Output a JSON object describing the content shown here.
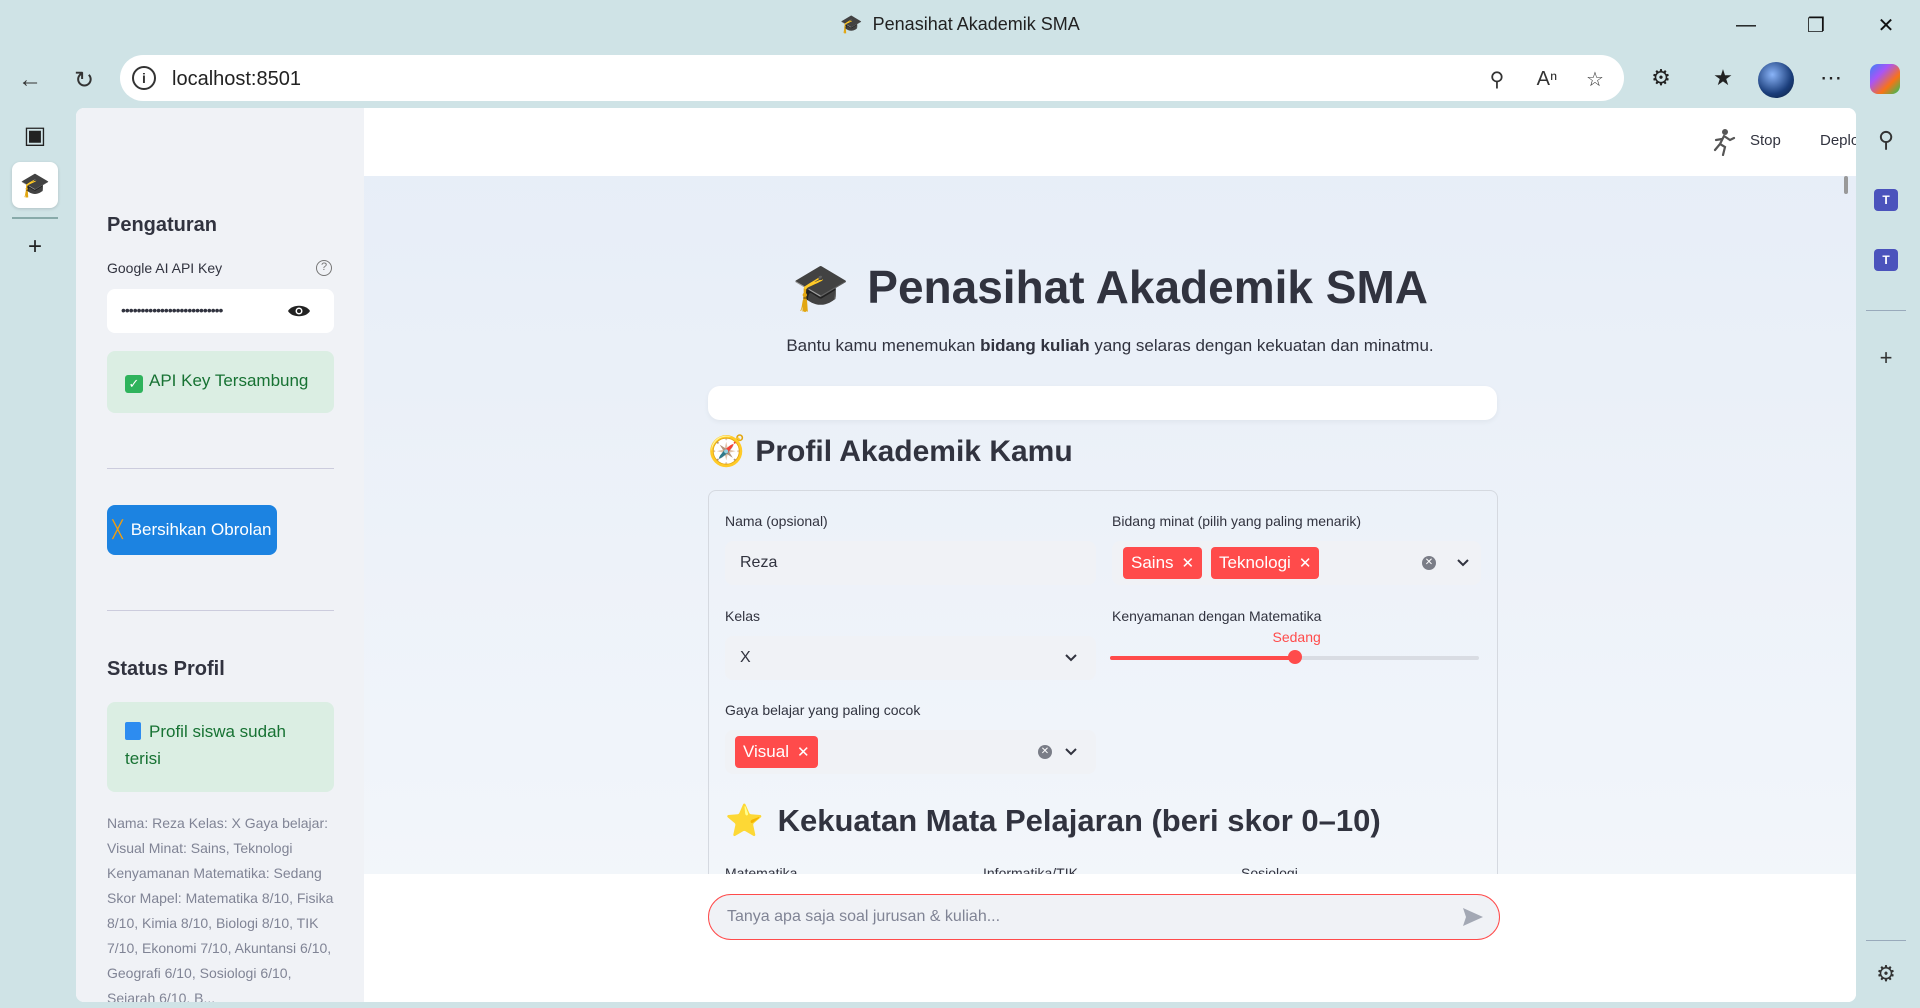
{
  "browser": {
    "window_title": "Penasihat Akademik SMA",
    "url": "localhost:8501"
  },
  "sidebar": {
    "settings_heading": "Pengaturan",
    "api_key_label": "Google AI API Key",
    "api_key_masked": "••••••••••••••••••••••••••",
    "api_status": "API Key Tersambung",
    "clear_button": "Bersihkan Obrolan",
    "profile_status_heading": "Status Profil",
    "profile_status_message": "Profil siswa sudah terisi",
    "profile_summary": "Nama: Reza Kelas: X Gaya belajar: Visual Minat: Sains, Teknologi Kenyamanan Matematika: Sedang Skor Mapel: Matematika 8/10, Fisika 8/10, Kimia 8/10, Biologi 8/10, TIK 7/10, Ekonomi 7/10, Akuntansi 6/10, Geografi 6/10, Sosiologi 6/10, Sejarah 6/10, B..."
  },
  "toolbar": {
    "stop_label": "Stop",
    "deploy_label": "Deploy"
  },
  "main": {
    "title": "Penasihat Akademik SMA",
    "subtitle_pre": "Bantu kamu menemukan ",
    "subtitle_bold": "bidang kuliah",
    "subtitle_post": " yang selaras dengan kekuatan dan minatmu.",
    "profile_section_title": "Profil Akademik Kamu",
    "form": {
      "name_label": "Nama (opsional)",
      "name_value": "Reza",
      "interest_label": "Bidang minat (pilih yang paling menarik)",
      "interest_tags": [
        "Sains",
        "Teknologi"
      ],
      "class_label": "Kelas",
      "class_value": "X",
      "math_comfort_label": "Kenyamanan dengan Matematika",
      "math_comfort_value": "Sedang",
      "math_comfort_fraction": 0.5,
      "learning_style_label": "Gaya belajar yang paling cocok",
      "learning_style_tags": [
        "Visual"
      ]
    },
    "strength_section_title": "Kekuatan Mata Pelajaran (beri skor 0–10)",
    "subject_headers": [
      "Matematika",
      "Informatika/TIK",
      "Sosiologi"
    ],
    "chat_placeholder": "Tanya apa saja soal jurusan & kuliah..."
  },
  "colors": {
    "accent": "#ff4b4b",
    "primary_button": "#1c83e1",
    "success_bg": "#dbeee3",
    "success_text": "#177233"
  }
}
